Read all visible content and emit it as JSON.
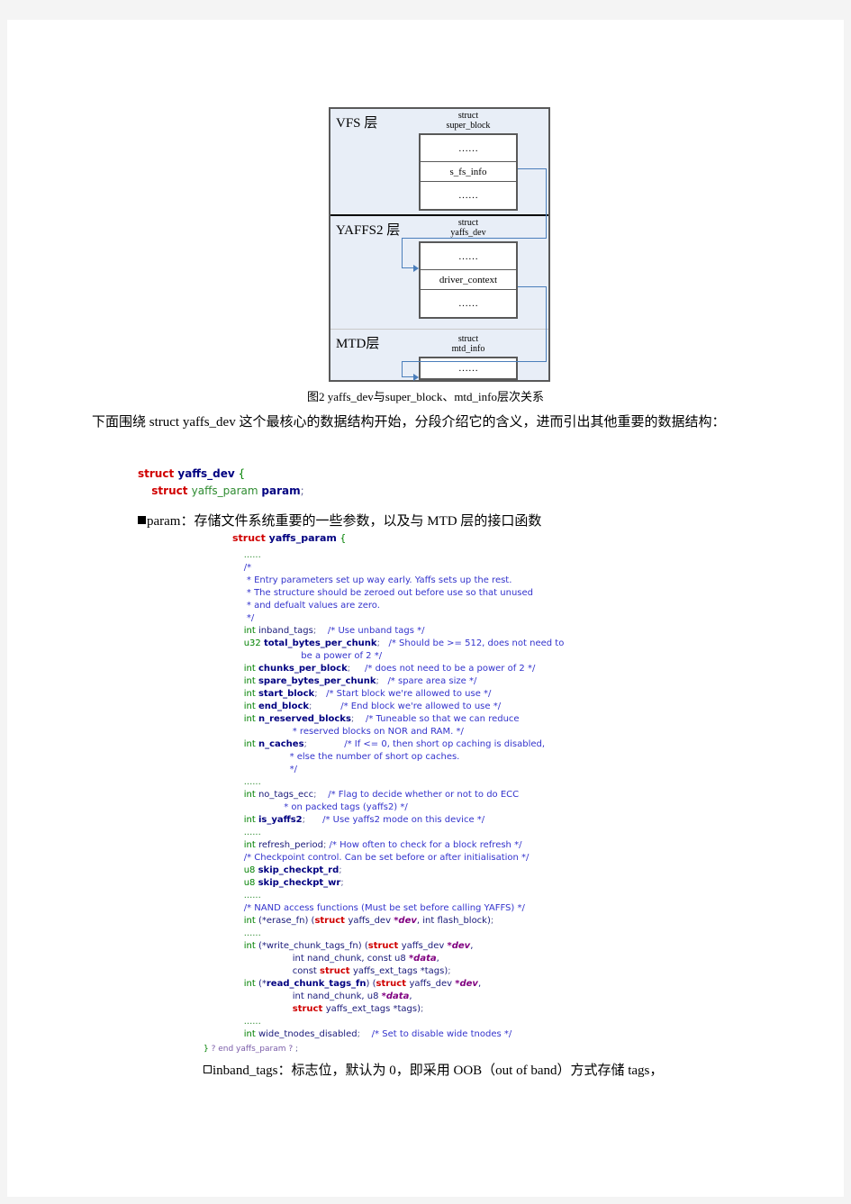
{
  "figure": {
    "layers": [
      {
        "label": "VFS 层",
        "struct_line1": "struct",
        "struct_line2": "super_block",
        "cells": [
          "……",
          "s_fs_info",
          "……"
        ]
      },
      {
        "label": "YAFFS2 层",
        "struct_line1": "struct",
        "struct_line2": "yaffs_dev",
        "cells": [
          "……",
          "driver_context",
          "……"
        ]
      },
      {
        "label": "MTD层",
        "struct_line1": "struct",
        "struct_line2": "mtd_info",
        "cells": [
          "……"
        ]
      }
    ],
    "caption": "图2 yaffs_dev与super_block、mtd_info层次关系",
    "connector_color": "#4a7ebb",
    "background_color": "#e8eef7",
    "border_color": "#595959"
  },
  "body": {
    "intro": "下面围绕 struct  yaffs_dev 这个最核心的数据结构开始，分段介绍它的含义，进而引出其他重要的数据结构：",
    "param_note": "param：存储文件系统重要的一些参数，以及与 MTD 层的接口函数",
    "tail_note": "inband_tags：标志位，默认为 0，即采用 OOB（out of band）方式存储 tags，"
  },
  "code": {
    "dev_block": [
      {
        "segs": [
          {
            "t": "struct ",
            "c": "k-struct"
          },
          {
            "t": "yaffs_dev",
            "c": "id-bold"
          },
          {
            "t": " {",
            "c": "k-brace"
          }
        ]
      },
      {
        "segs": [
          {
            "t": "    ",
            "c": ""
          },
          {
            "t": "struct ",
            "c": "k-struct"
          },
          {
            "t": "yaffs_param",
            "c": "id-green"
          },
          {
            "t": " ",
            "c": ""
          },
          {
            "t": "param",
            "c": "id-bold"
          },
          {
            "t": ";",
            "c": "punc"
          }
        ]
      }
    ],
    "param_open": [
      {
        "segs": [
          {
            "t": "struct ",
            "c": "k-struct"
          },
          {
            "t": "yaffs_param",
            "c": "id-bold"
          },
          {
            "t": " {",
            "c": "k-brace"
          }
        ]
      }
    ],
    "main_block": [
      {
        "segs": [
          {
            "t": "    ......",
            "c": "dots"
          }
        ]
      },
      {
        "segs": [
          {
            "t": "    /*",
            "c": "cmt"
          }
        ]
      },
      {
        "segs": [
          {
            "t": "     * Entry parameters set up way early. Yaffs sets up the rest.",
            "c": "cmt"
          }
        ]
      },
      {
        "segs": [
          {
            "t": "     * The structure should be zeroed out before use so that unused",
            "c": "cmt"
          }
        ]
      },
      {
        "segs": [
          {
            "t": "     * and defualt values are zero.",
            "c": "cmt"
          }
        ]
      },
      {
        "segs": [
          {
            "t": "     */",
            "c": "cmt"
          }
        ]
      },
      {
        "segs": [
          {
            "t": "    ",
            "c": ""
          },
          {
            "t": "int",
            "c": "k-type"
          },
          {
            "t": " inband_tags",
            "c": "id"
          },
          {
            "t": ";",
            "c": "punc"
          },
          {
            "t": "    /* Use unband tags */",
            "c": "cmt"
          }
        ]
      },
      {
        "segs": [
          {
            "t": "    ",
            "c": ""
          },
          {
            "t": "u32",
            "c": "k-type"
          },
          {
            "t": " ",
            "c": ""
          },
          {
            "t": "total_bytes_per_chunk",
            "c": "id-bold"
          },
          {
            "t": ";",
            "c": "punc"
          },
          {
            "t": "   /* Should be >= 512, does not need to",
            "c": "cmt"
          }
        ]
      },
      {
        "segs": [
          {
            "t": "                        be a power of 2 */",
            "c": "cmt"
          }
        ]
      },
      {
        "segs": [
          {
            "t": "    ",
            "c": ""
          },
          {
            "t": "int",
            "c": "k-type"
          },
          {
            "t": " ",
            "c": ""
          },
          {
            "t": "chunks_per_block",
            "c": "id-bold"
          },
          {
            "t": ";",
            "c": "punc"
          },
          {
            "t": "     /* does not need to be a power of 2 */",
            "c": "cmt"
          }
        ]
      },
      {
        "segs": [
          {
            "t": "    ",
            "c": ""
          },
          {
            "t": "int",
            "c": "k-type"
          },
          {
            "t": " ",
            "c": ""
          },
          {
            "t": "spare_bytes_per_chunk",
            "c": "id-bold"
          },
          {
            "t": ";",
            "c": "punc"
          },
          {
            "t": "   /* spare area size */",
            "c": "cmt"
          }
        ]
      },
      {
        "segs": [
          {
            "t": "    ",
            "c": ""
          },
          {
            "t": "int",
            "c": "k-type"
          },
          {
            "t": " ",
            "c": ""
          },
          {
            "t": "start_block",
            "c": "id-bold"
          },
          {
            "t": ";",
            "c": "punc"
          },
          {
            "t": "   /* Start block we're allowed to use */",
            "c": "cmt"
          }
        ]
      },
      {
        "segs": [
          {
            "t": "    ",
            "c": ""
          },
          {
            "t": "int",
            "c": "k-type"
          },
          {
            "t": " ",
            "c": ""
          },
          {
            "t": "end_block",
            "c": "id-bold"
          },
          {
            "t": ";",
            "c": "punc"
          },
          {
            "t": "          /* End block we're allowed to use */",
            "c": "cmt"
          }
        ]
      },
      {
        "segs": [
          {
            "t": "    ",
            "c": ""
          },
          {
            "t": "int",
            "c": "k-type"
          },
          {
            "t": " ",
            "c": ""
          },
          {
            "t": "n_reserved_blocks",
            "c": "id-bold"
          },
          {
            "t": ";",
            "c": "punc"
          },
          {
            "t": "    /* Tuneable so that we can reduce",
            "c": "cmt"
          }
        ]
      },
      {
        "segs": [
          {
            "t": "                     * reserved blocks on NOR and RAM. */",
            "c": "cmt"
          }
        ]
      },
      {
        "segs": [
          {
            "t": "    ",
            "c": ""
          },
          {
            "t": "int",
            "c": "k-type"
          },
          {
            "t": " ",
            "c": ""
          },
          {
            "t": "n_caches",
            "c": "id-bold"
          },
          {
            "t": ";",
            "c": "punc"
          },
          {
            "t": "             /* If <= 0, then short op caching is disabled,",
            "c": "cmt"
          }
        ]
      },
      {
        "segs": [
          {
            "t": "                    * else the number of short op caches.",
            "c": "cmt"
          }
        ]
      },
      {
        "segs": [
          {
            "t": "                    */",
            "c": "cmt"
          }
        ]
      },
      {
        "segs": [
          {
            "t": "    ......",
            "c": "dots"
          }
        ]
      },
      {
        "segs": [
          {
            "t": "    ",
            "c": ""
          },
          {
            "t": "int",
            "c": "k-type"
          },
          {
            "t": " no_tags_ecc",
            "c": "id"
          },
          {
            "t": ";",
            "c": "punc"
          },
          {
            "t": "    /* Flag to decide whether or not to do ECC",
            "c": "cmt"
          }
        ]
      },
      {
        "segs": [
          {
            "t": "                  * on packed tags (yaffs2) */",
            "c": "cmt"
          }
        ]
      },
      {
        "segs": [
          {
            "t": "    ",
            "c": ""
          },
          {
            "t": "int",
            "c": "k-type"
          },
          {
            "t": " ",
            "c": ""
          },
          {
            "t": "is_yaffs2",
            "c": "id-bold"
          },
          {
            "t": ";",
            "c": "punc"
          },
          {
            "t": "      /* Use yaffs2 mode on this device */",
            "c": "cmt"
          }
        ]
      },
      {
        "segs": [
          {
            "t": "    ......",
            "c": "dots"
          }
        ]
      },
      {
        "segs": [
          {
            "t": "    ",
            "c": ""
          },
          {
            "t": "int",
            "c": "k-type"
          },
          {
            "t": " refresh_period",
            "c": "id"
          },
          {
            "t": ";",
            "c": "punc"
          },
          {
            "t": " /* How often to check for a block refresh */",
            "c": "cmt"
          }
        ]
      },
      {
        "segs": [
          {
            "t": "    /* Checkpoint control. Can be set before or after initialisation */",
            "c": "cmt"
          }
        ]
      },
      {
        "segs": [
          {
            "t": "    ",
            "c": ""
          },
          {
            "t": "u8",
            "c": "k-type"
          },
          {
            "t": " ",
            "c": ""
          },
          {
            "t": "skip_checkpt_rd",
            "c": "id-bold"
          },
          {
            "t": ";",
            "c": "punc"
          }
        ]
      },
      {
        "segs": [
          {
            "t": "    ",
            "c": ""
          },
          {
            "t": "u8",
            "c": "k-type"
          },
          {
            "t": " ",
            "c": ""
          },
          {
            "t": "skip_checkpt_wr",
            "c": "id-bold"
          },
          {
            "t": ";",
            "c": "punc"
          }
        ]
      },
      {
        "segs": [
          {
            "t": "    ......",
            "c": "dots"
          }
        ]
      },
      {
        "segs": [
          {
            "t": "    /* NAND access functions (Must be set before calling YAFFS) */",
            "c": "cmt"
          }
        ]
      },
      {
        "segs": [
          {
            "t": "    ",
            "c": ""
          },
          {
            "t": "int",
            "c": "k-type"
          },
          {
            "t": " (*erase_fn) (",
            "c": "id"
          },
          {
            "t": "struct ",
            "c": "k-struct"
          },
          {
            "t": "yaffs_dev ",
            "c": "id"
          },
          {
            "t": "*dev",
            "c": "ptr"
          },
          {
            "t": ", int flash_block)",
            "c": "id"
          },
          {
            "t": ";",
            "c": "punc"
          }
        ]
      },
      {
        "segs": [
          {
            "t": "    ......",
            "c": "dots"
          }
        ]
      },
      {
        "segs": [
          {
            "t": "    ",
            "c": ""
          },
          {
            "t": "int",
            "c": "k-type"
          },
          {
            "t": " (*write_chunk_tags_fn) (",
            "c": "id"
          },
          {
            "t": "struct ",
            "c": "k-struct"
          },
          {
            "t": "yaffs_dev ",
            "c": "id"
          },
          {
            "t": "*dev",
            "c": "ptr"
          },
          {
            "t": ",",
            "c": "id"
          }
        ]
      },
      {
        "segs": [
          {
            "t": "                     int nand_chunk, const u8 ",
            "c": "id"
          },
          {
            "t": "*data",
            "c": "ptr"
          },
          {
            "t": ",",
            "c": "id"
          }
        ]
      },
      {
        "segs": [
          {
            "t": "                     const ",
            "c": "id"
          },
          {
            "t": "struct ",
            "c": "k-struct"
          },
          {
            "t": "yaffs_ext_tags *tags)",
            "c": "id"
          },
          {
            "t": ";",
            "c": "punc"
          }
        ]
      },
      {
        "segs": [
          {
            "t": "    ",
            "c": ""
          },
          {
            "t": "int",
            "c": "k-type"
          },
          {
            "t": " (*",
            "c": "id"
          },
          {
            "t": "read_chunk_tags_fn",
            "c": "id-bold"
          },
          {
            "t": ") (",
            "c": "id"
          },
          {
            "t": "struct ",
            "c": "k-struct"
          },
          {
            "t": "yaffs_dev ",
            "c": "id"
          },
          {
            "t": "*dev",
            "c": "ptr"
          },
          {
            "t": ",",
            "c": "id"
          }
        ]
      },
      {
        "segs": [
          {
            "t": "                     int nand_chunk, u8 ",
            "c": "id"
          },
          {
            "t": "*data",
            "c": "ptr"
          },
          {
            "t": ",",
            "c": "id"
          }
        ]
      },
      {
        "segs": [
          {
            "t": "                     ",
            "c": ""
          },
          {
            "t": "struct ",
            "c": "k-struct"
          },
          {
            "t": "yaffs_ext_tags *tags)",
            "c": "id"
          },
          {
            "t": ";",
            "c": "punc"
          }
        ]
      },
      {
        "segs": [
          {
            "t": "    ......",
            "c": "dots"
          }
        ]
      },
      {
        "segs": [
          {
            "t": "    ",
            "c": ""
          },
          {
            "t": "int",
            "c": "k-type"
          },
          {
            "t": " wide_tnodes_disabled",
            "c": "id"
          },
          {
            "t": ";",
            "c": "punc"
          },
          {
            "t": "    /* Set to disable wide tnodes */",
            "c": "cmt"
          }
        ]
      }
    ],
    "close_block": [
      {
        "segs": [
          {
            "t": "} ",
            "c": "k-brace"
          },
          {
            "t": "? end yaffs_param ? ",
            "c": "qmark"
          },
          {
            "t": ";",
            "c": "punc"
          }
        ]
      }
    ]
  }
}
